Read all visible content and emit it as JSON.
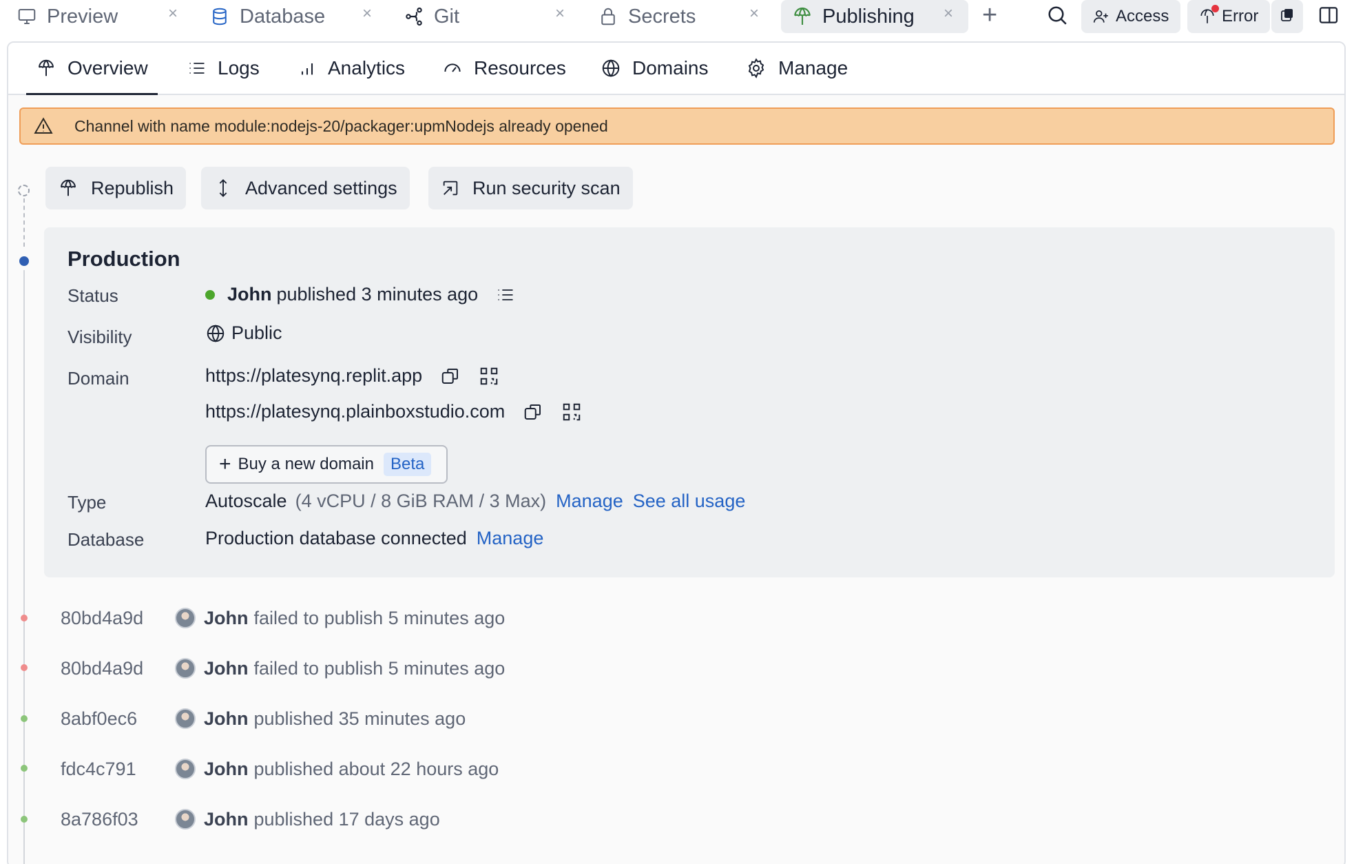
{
  "workspace_tabs": [
    {
      "label": "Preview",
      "icon": "monitor-icon"
    },
    {
      "label": "Database",
      "icon": "database-icon"
    },
    {
      "label": "Git",
      "icon": "git-branch-icon"
    },
    {
      "label": "Secrets",
      "icon": "lock-icon"
    },
    {
      "label": "Publishing",
      "icon": "publish-icon",
      "active": true
    }
  ],
  "toolbar": {
    "access_label": "Access",
    "error_label": "Error"
  },
  "subtabs": [
    {
      "label": "Overview",
      "icon": "publish-icon",
      "active": true
    },
    {
      "label": "Logs",
      "icon": "list-icon"
    },
    {
      "label": "Analytics",
      "icon": "bar-chart-icon"
    },
    {
      "label": "Resources",
      "icon": "gauge-icon"
    },
    {
      "label": "Domains",
      "icon": "globe-icon"
    },
    {
      "label": "Manage",
      "icon": "gear-icon"
    }
  ],
  "banner": {
    "message": "Channel with name module:nodejs-20/packager:upmNodejs already opened"
  },
  "actions": {
    "republish": "Republish",
    "advanced_settings": "Advanced settings",
    "security_scan": "Run security scan"
  },
  "production": {
    "title": "Production",
    "labels": {
      "status": "Status",
      "visibility": "Visibility",
      "domain": "Domain",
      "type": "Type",
      "database": "Database"
    },
    "status_user": "John",
    "status_text": "published 3 minutes ago",
    "visibility": "Public",
    "domains": [
      "https://platesynq.replit.app",
      "https://platesynq.plainboxstudio.com"
    ],
    "buy_domain_label": "Buy a new domain",
    "beta_badge": "Beta",
    "type_value": "Autoscale",
    "type_detail": "(4 vCPU / 8 GiB RAM / 3 Max)",
    "type_manage": "Manage",
    "type_usage": "See all usage",
    "database_value": "Production database connected",
    "database_manage": "Manage"
  },
  "history": [
    {
      "hash": "80bd4a9d",
      "user": "John",
      "text": "failed to publish 5 minutes ago",
      "status": "failed"
    },
    {
      "hash": "80bd4a9d",
      "user": "John",
      "text": "failed to publish 5 minutes ago",
      "status": "failed"
    },
    {
      "hash": "8abf0ec6",
      "user": "John",
      "text": "published 35 minutes ago",
      "status": "success"
    },
    {
      "hash": "fdc4c791",
      "user": "John",
      "text": "published about 22 hours ago",
      "status": "success"
    },
    {
      "hash": "8a786f03",
      "user": "John",
      "text": "published 17 days ago",
      "status": "success"
    }
  ],
  "colors": {
    "accent_link": "#2463c5",
    "status_success": "#4ca62c",
    "status_failed": "#ef8c8c",
    "banner_bg": "#f8cfa0",
    "banner_border": "#ef9d57"
  }
}
